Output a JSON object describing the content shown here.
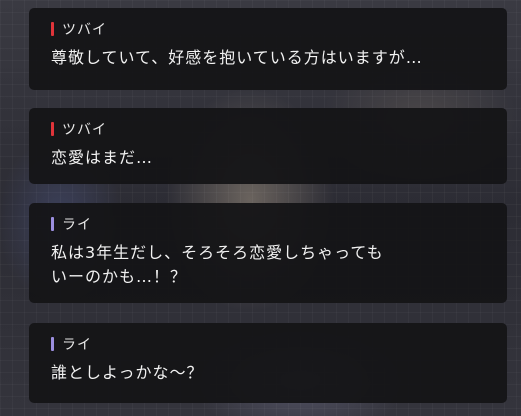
{
  "colors": {
    "tsubai_accent": "#e0343a",
    "rai_accent": "#9c8fe0"
  },
  "messages": [
    {
      "speaker": "ツバイ",
      "accent": "tsubai_accent",
      "lines": [
        "尊敬していて、好感を抱いている方はいますが…"
      ]
    },
    {
      "speaker": "ツバイ",
      "accent": "tsubai_accent",
      "lines": [
        "恋愛はまだ…"
      ]
    },
    {
      "speaker": "ライ",
      "accent": "rai_accent",
      "lines": [
        "私は3年生だし、そろそろ恋愛しちゃっても",
        "いーのかも…！？"
      ]
    },
    {
      "speaker": "ライ",
      "accent": "rai_accent",
      "lines": [
        "誰としよっかな～？"
      ]
    }
  ]
}
